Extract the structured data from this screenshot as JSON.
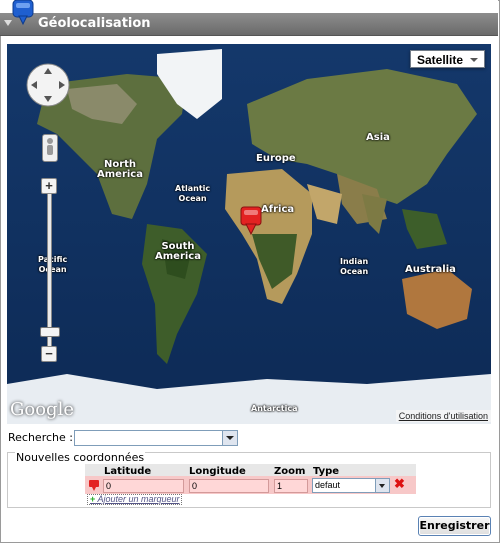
{
  "header": {
    "title": "Géolocalisation"
  },
  "map": {
    "type_control": "Satellite",
    "labels": {
      "north_america": "North\nAmerica",
      "atlantic": "Atlantic\nOcean",
      "south_america": "South\nAmerica",
      "pacific": "Pacific\nOcean",
      "europe": "Europe",
      "africa": "Africa",
      "asia": "Asia",
      "indian": "Indian\nOcean",
      "australia": "Australia",
      "antarctica": "Antarctica"
    },
    "logo": "Google",
    "terms": "Conditions d'utilisation"
  },
  "search": {
    "label": "Recherche :",
    "value": ""
  },
  "coords": {
    "legend": "Nouvelles coordonnées",
    "columns": {
      "latitude": "Latitude",
      "longitude": "Longitude",
      "zoom": "Zoom",
      "type": "Type"
    },
    "row": {
      "latitude": "0",
      "longitude": "0",
      "zoom": "1",
      "type": "defaut"
    },
    "add_link": "Ajouter un marqueur"
  },
  "actions": {
    "save": "Enregistrer"
  },
  "colors": {
    "marker": "#e32222",
    "row_invalid": "#f7c8c8",
    "header": "#7a7a7a"
  }
}
